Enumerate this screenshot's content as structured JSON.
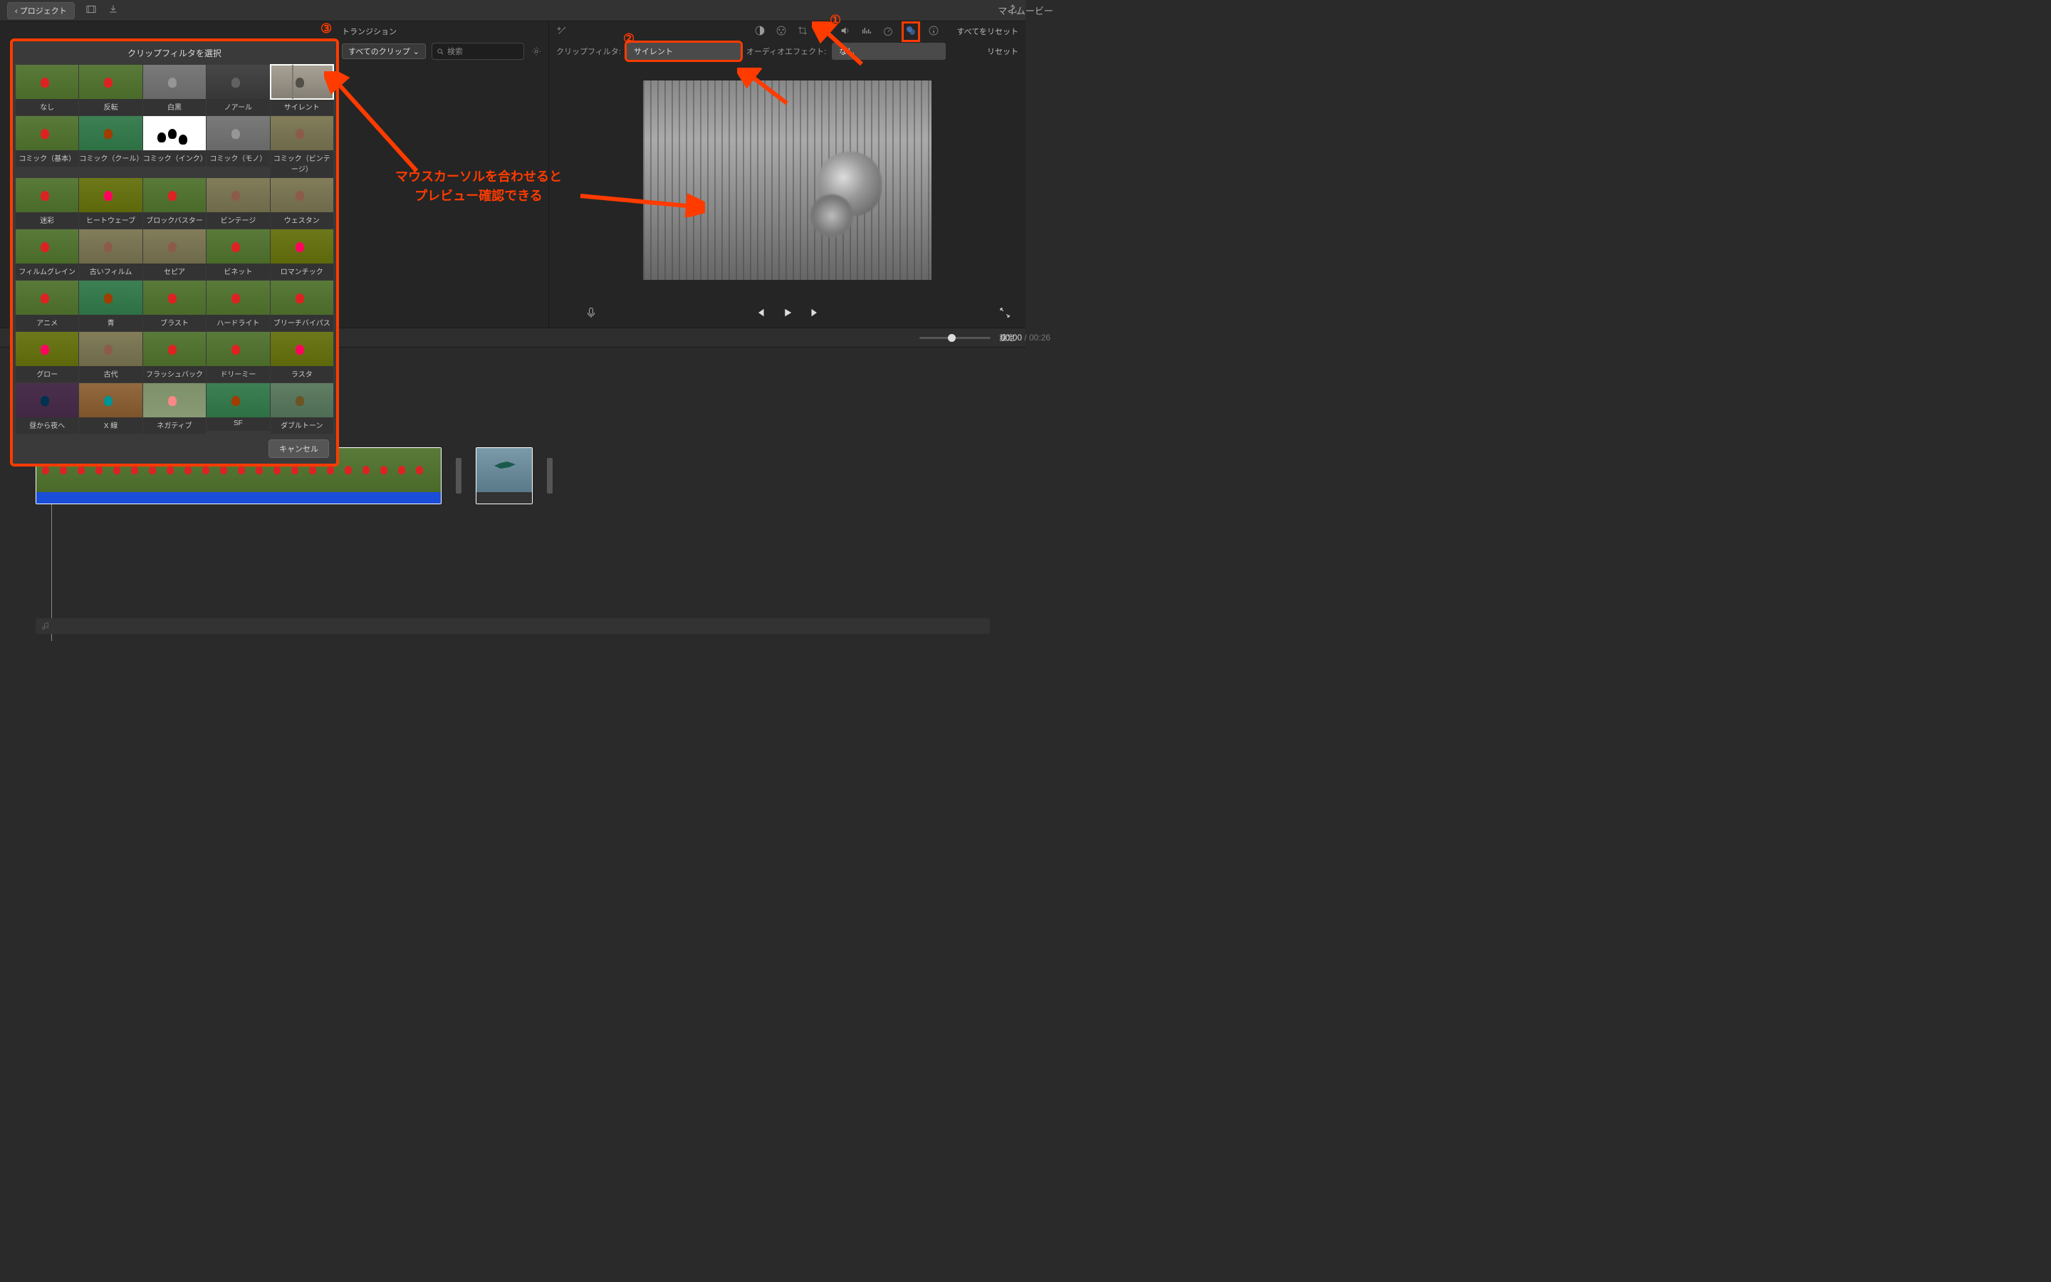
{
  "topbar": {
    "back": "プロジェクト",
    "title": "マイムービー"
  },
  "tabs": {
    "transition": "トランジション"
  },
  "browser": {
    "allClips": "すべてのクリップ",
    "searchPlaceholder": "検索"
  },
  "adjust": {
    "resetAll": "すべてをリセット",
    "clipFilterLabel": "クリップフィルタ:",
    "clipFilterValue": "サイレント",
    "audioEffectLabel": "オーディオエフェクト:",
    "audioEffectValue": "なし",
    "reset": "リセット"
  },
  "time": {
    "current": "00:00",
    "duration": "00:26",
    "settings": "設定"
  },
  "popup": {
    "title": "クリップフィルタを選択",
    "cancel": "キャンセル",
    "filters": [
      {
        "name": "なし",
        "cls": ""
      },
      {
        "name": "反転",
        "cls": ""
      },
      {
        "name": "白黒",
        "cls": "bw"
      },
      {
        "name": "ノアール",
        "cls": "noir"
      },
      {
        "name": "サイレント",
        "cls": "silent",
        "sel": true
      },
      {
        "name": "コミック（基本）",
        "cls": ""
      },
      {
        "name": "コミック（クール）",
        "cls": "cool"
      },
      {
        "name": "コミック（インク）",
        "cls": "ink"
      },
      {
        "name": "コミック（モノ）",
        "cls": "bw"
      },
      {
        "name": "コミック（ビンテージ）",
        "cls": "sepia"
      },
      {
        "name": "迷彩",
        "cls": ""
      },
      {
        "name": "ヒートウェーブ",
        "cls": "warm"
      },
      {
        "name": "ブロックバスター",
        "cls": ""
      },
      {
        "name": "ビンテージ",
        "cls": "sepia"
      },
      {
        "name": "ウェスタン",
        "cls": "sepia"
      },
      {
        "name": "フィルムグレイン",
        "cls": ""
      },
      {
        "name": "古いフィルム",
        "cls": "sepia"
      },
      {
        "name": "セピア",
        "cls": "sepia"
      },
      {
        "name": "ビネット",
        "cls": ""
      },
      {
        "name": "ロマンチック",
        "cls": "warm"
      },
      {
        "name": "アニメ",
        "cls": ""
      },
      {
        "name": "青",
        "cls": "cool"
      },
      {
        "name": "ブラスト",
        "cls": ""
      },
      {
        "name": "ハードライト",
        "cls": ""
      },
      {
        "name": "ブリーチバイパス",
        "cls": ""
      },
      {
        "name": "グロー",
        "cls": "warm"
      },
      {
        "name": "古代",
        "cls": "sepia"
      },
      {
        "name": "フラッシュバック",
        "cls": ""
      },
      {
        "name": "ドリーミー",
        "cls": ""
      },
      {
        "name": "ラスタ",
        "cls": "warm"
      },
      {
        "name": "昼から夜へ",
        "cls": "night"
      },
      {
        "name": "X 線",
        "cls": "xray"
      },
      {
        "name": "ネガティブ",
        "cls": "neg"
      },
      {
        "name": "SF",
        "cls": "cool"
      },
      {
        "name": "ダブルトーン",
        "cls": "dual"
      }
    ]
  },
  "anno": {
    "n1": "①",
    "n2": "②",
    "n3": "③",
    "text1": "マウスカーソルを合わせると",
    "text2": "プレビュー確認できる"
  }
}
